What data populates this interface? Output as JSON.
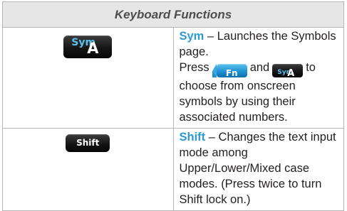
{
  "table": {
    "header": "Keyboard Functions",
    "rows": [
      {
        "key": {
          "sym": "Sym",
          "letter": "A"
        },
        "term": "Sym",
        "dash": " – ",
        "line1": "Launches the Symbols page.",
        "press": "Press",
        "fn_label": "Fn",
        "and": "and",
        "small_sym": "Sym",
        "small_letter": "A",
        "rest": "to choose from onscreen symbols by using their associated numbers."
      },
      {
        "key": {
          "label": "Shift"
        },
        "term": "Shift",
        "dash": " – ",
        "text": "Changes the text input mode among Upper/Lower/Mixed case modes. (Press twice to turn Shift lock on.)"
      }
    ]
  },
  "colors": {
    "accent": "#2c9ad2",
    "header_bg": "#e6e6e6",
    "border": "#b7b7b7"
  }
}
